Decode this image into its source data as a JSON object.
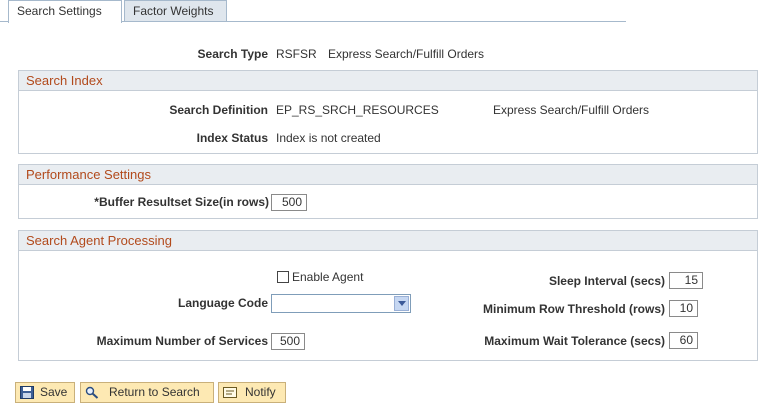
{
  "tabs": [
    {
      "label": "Search Settings",
      "active": true
    },
    {
      "label": "Factor Weights",
      "active": false
    }
  ],
  "search_type": {
    "label": "Search Type",
    "code": "RSFSR",
    "description": "Express Search/Fulfill Orders"
  },
  "search_index": {
    "title": "Search Index",
    "definition_label": "Search Definition",
    "definition_value": "EP_RS_SRCH_RESOURCES",
    "definition_desc": "Express Search/Fulfill Orders",
    "status_label": "Index Status",
    "status_value": "Index is not created"
  },
  "performance": {
    "title": "Performance Settings",
    "buffer_label": "*Buffer Resultset Size(in rows)",
    "buffer_value": "500"
  },
  "agent": {
    "title": "Search Agent Processing",
    "enable_label": "Enable Agent",
    "enable_checked": false,
    "language_label": "Language Code",
    "language_value": "",
    "max_services_label": "Maximum Number of Services",
    "max_services_value": "500",
    "sleep_label": "Sleep Interval (secs)",
    "sleep_value": "15",
    "min_row_label": "Minimum Row Threshold (rows)",
    "min_row_value": "10",
    "max_wait_label": "Maximum Wait Tolerance (secs)",
    "max_wait_value": "60"
  },
  "toolbar": {
    "save_label": "Save",
    "return_label": "Return to Search",
    "notify_label": "Notify"
  }
}
